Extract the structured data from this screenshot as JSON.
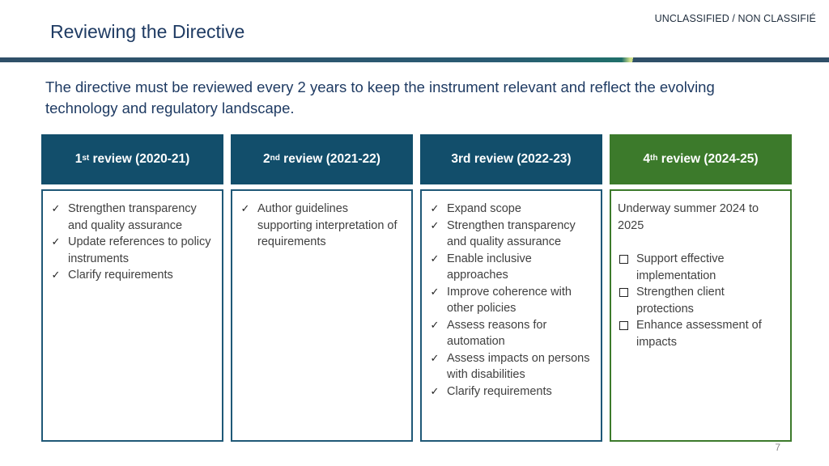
{
  "classification": "UNCLASSIFIED / NON CLASSIFIÉ",
  "page_title": "Reviewing the Directive",
  "intro": "The directive must be reviewed every 2 years to keep the instrument relevant and reflect the evolving technology and regulatory landscape.",
  "columns": [
    {
      "num": "1",
      "sup": "st",
      "rest": " review (2020-21)",
      "items": [
        "Strengthen transparency and quality assurance",
        "Update references to policy instruments",
        "Clarify requirements"
      ]
    },
    {
      "num": "2",
      "sup": "nd",
      "rest": " review (2021-22)",
      "items": [
        "Author guidelines supporting interpretation of requirements"
      ]
    },
    {
      "num": "3rd",
      "sup": "",
      "rest": " review (2022-23)",
      "items": [
        "Expand scope",
        "Strengthen transparency and quality assurance",
        "Enable inclusive approaches",
        "Improve coherence with other policies",
        "Assess reasons for automation",
        "Assess impacts on persons with disabilities",
        "Clarify requirements"
      ]
    },
    {
      "num": "4",
      "sup": "th",
      "rest": " review (2024-25)",
      "status": "Underway summer 2024 to 2025",
      "items": [
        "Support effective implementation",
        "Strengthen client protections",
        "Enhance assessment of impacts"
      ]
    }
  ],
  "check_glyph": "✓",
  "page_number": "7",
  "colors": {
    "navy": "#124e6b",
    "green": "#3c7a2b",
    "title": "#1f3b63"
  }
}
